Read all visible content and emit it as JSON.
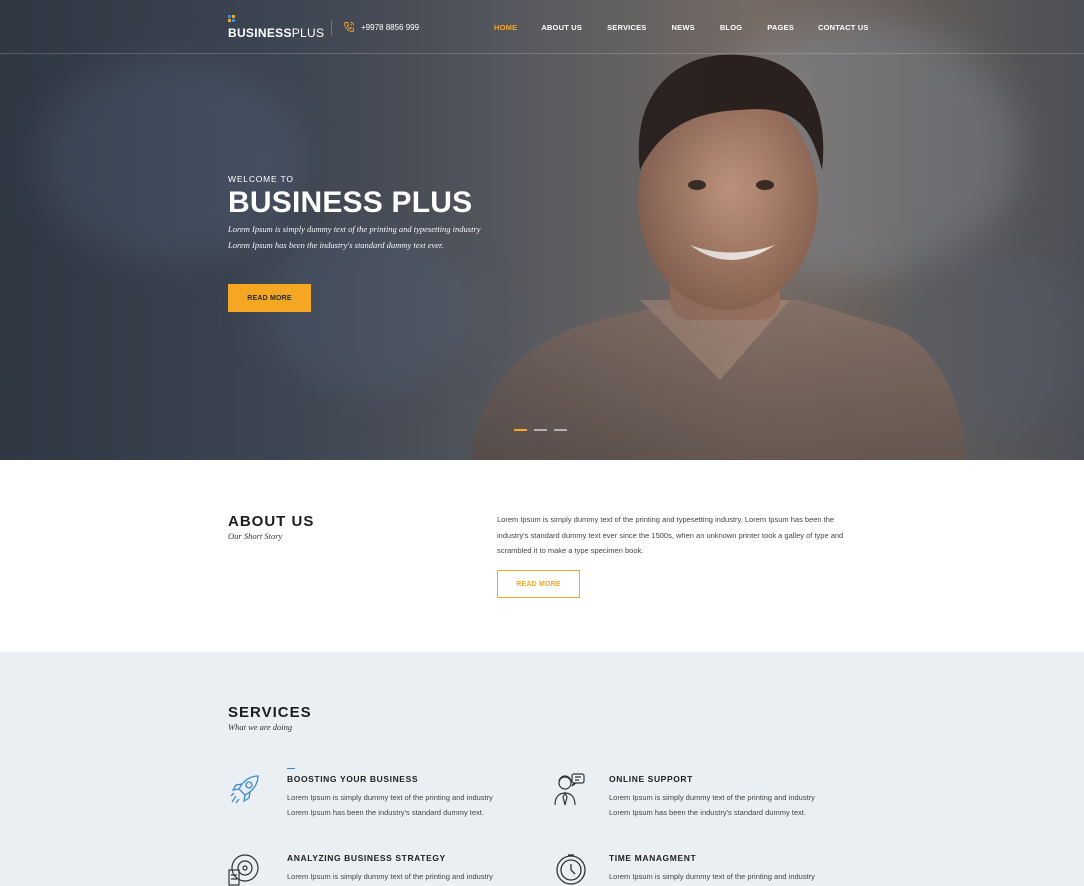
{
  "brand": {
    "name_bold": "BUSINESS",
    "name_light": "PLUS",
    "colors": {
      "accent": "#f5a623",
      "logo_blue": "#3b8ccf",
      "logo_orange": "#f5a623"
    }
  },
  "header": {
    "phone": "+9978 8856 999",
    "phone_icon": "phone-icon"
  },
  "nav": {
    "items": [
      {
        "label": "HOME",
        "active": true
      },
      {
        "label": "ABOUT US",
        "active": false
      },
      {
        "label": "SERVICES",
        "active": false
      },
      {
        "label": "NEWS",
        "active": false
      },
      {
        "label": "BLOG",
        "active": false
      },
      {
        "label": "PAGES",
        "active": false
      },
      {
        "label": "CONTACT US",
        "active": false
      }
    ]
  },
  "hero": {
    "kicker": "WELCOME TO",
    "title": "BUSINESS PLUS",
    "line1": "Lorem Ipsum is simply dummy text of the printing and typesetting industry",
    "line2": "Lorem Ipsum has been the industry's standard dummy text ever.",
    "button": "READ MORE",
    "slides": {
      "count": 3,
      "active_index": 0
    }
  },
  "about": {
    "title": "ABOUT US",
    "subtitle": "Our Short Story",
    "text": "Lorem Ipsum is simply dummy text of the printing and typesetting industry. Lorem Ipsum has been the industry's standard dummy text ever since the 1500s, when an unknown printer took a galley of type and scrambled it to make a type specimen book.",
    "button": "READ MORE"
  },
  "services": {
    "title": "SERVICES",
    "subtitle": "What we are doing",
    "items": [
      {
        "title": "BOOSTING YOUR BUSINESS",
        "line1": "Lorem Ipsum is simply dummy text of the printing and industry",
        "line2": "Lorem Ipsum has been the industry's standard dummy text.",
        "icon": "rocket-icon"
      },
      {
        "title": "ONLINE SUPPORT",
        "line1": "Lorem Ipsum is simply dummy text of the printing and industry",
        "line2": "Lorem Ipsum has been the industry's standard dummy text.",
        "icon": "support-agent-icon"
      },
      {
        "title": "ANALYZING BUSINESS STRATEGY",
        "line1": "Lorem Ipsum is simply dummy text of the printing and industry",
        "line2": "",
        "icon": "strategy-icon"
      },
      {
        "title": "TIME MANAGMENT",
        "line1": "Lorem Ipsum is simply dummy text of the printing and industry",
        "line2": "",
        "icon": "clock-icon"
      }
    ]
  }
}
